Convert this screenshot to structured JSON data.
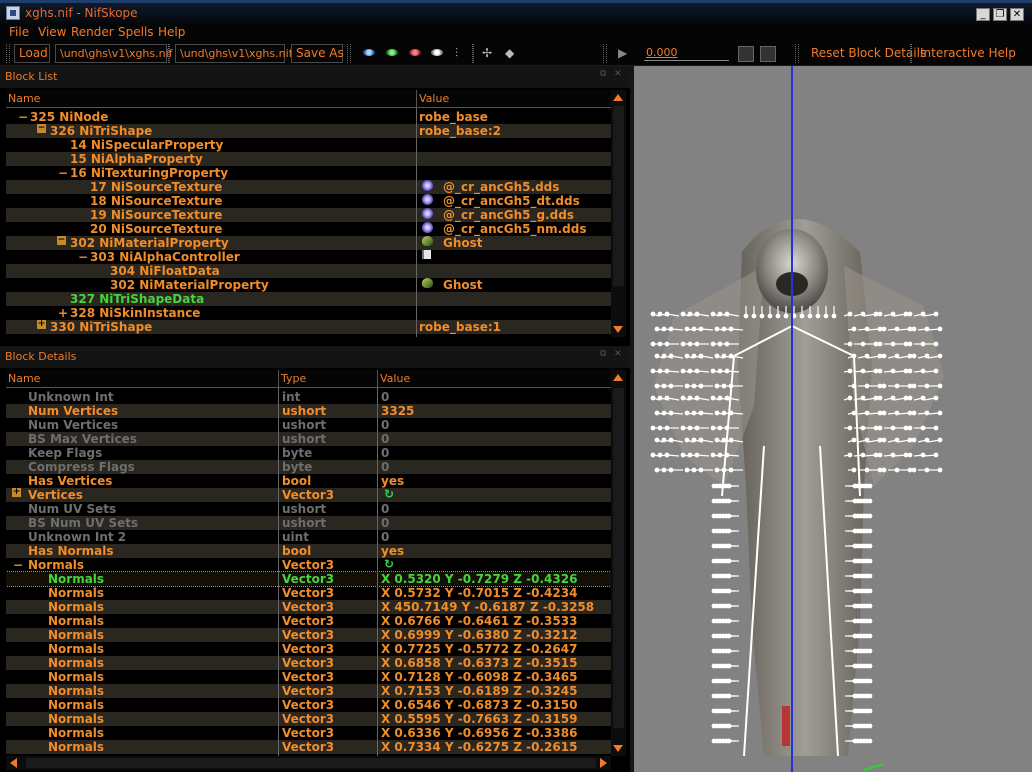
{
  "window": {
    "title": "xghs.nif - NifSkope"
  },
  "menu": [
    "File",
    "View",
    "Render",
    "Spells",
    "Help"
  ],
  "toolbar": {
    "load_label": "Load",
    "path1": "\\und\\ghs\\v1\\xghs.nif",
    "path2": "\\und\\ghs\\v1\\xghs.nif",
    "save_label": "Save As",
    "time_value": "0.000",
    "reset_label": "Reset Block Details",
    "help_label": "Interactive Help"
  },
  "block_list": {
    "title": "Block List",
    "columns": [
      "Name",
      "Value"
    ],
    "rows": [
      {
        "exp": "-",
        "name": "325 NiNode",
        "value": "robe_base",
        "depth": 0,
        "color": "o",
        "icon": ""
      },
      {
        "exp": "box-",
        "name": "326 NiTriShape",
        "value": "robe_base:2",
        "depth": 1,
        "color": "o",
        "icon": ""
      },
      {
        "exp": "",
        "name": "14 NiSpecularProperty",
        "value": "",
        "depth": 2,
        "color": "o",
        "icon": ""
      },
      {
        "exp": "",
        "name": "15 NiAlphaProperty",
        "value": "",
        "depth": 2,
        "color": "o",
        "icon": ""
      },
      {
        "exp": "-",
        "name": "16 NiTexturingProperty",
        "value": "",
        "depth": 2,
        "color": "o",
        "icon": ""
      },
      {
        "exp": "",
        "name": "17 NiSourceTexture",
        "value": "@_cr_ancGh5.dds",
        "depth": 3,
        "color": "o",
        "icon": "tex"
      },
      {
        "exp": "",
        "name": "18 NiSourceTexture",
        "value": "@_cr_ancGh5_dt.dds",
        "depth": 3,
        "color": "o",
        "icon": "tex"
      },
      {
        "exp": "",
        "name": "19 NiSourceTexture",
        "value": "@_cr_ancGh5_g.dds",
        "depth": 3,
        "color": "o",
        "icon": "tex"
      },
      {
        "exp": "",
        "name": "20 NiSourceTexture",
        "value": "@_cr_ancGh5_nm.dds",
        "depth": 3,
        "color": "o",
        "icon": "tex"
      },
      {
        "exp": "box-",
        "name": "302 NiMaterialProperty",
        "value": "Ghost",
        "depth": 2,
        "color": "o",
        "icon": "mat"
      },
      {
        "exp": "-",
        "name": "303 NiAlphaController",
        "value": "",
        "depth": 3,
        "color": "o",
        "icon": "flag"
      },
      {
        "exp": "",
        "name": "304 NiFloatData",
        "value": "",
        "depth": 4,
        "color": "o",
        "icon": ""
      },
      {
        "exp": "",
        "name": "302 NiMaterialProperty",
        "value": "Ghost",
        "depth": 4,
        "color": "o",
        "icon": "mat"
      },
      {
        "exp": "",
        "name": "327 NiTriShapeData",
        "value": "",
        "depth": 2,
        "color": "g",
        "icon": ""
      },
      {
        "exp": "+",
        "name": "328 NiSkinInstance",
        "value": "",
        "depth": 2,
        "color": "o",
        "icon": ""
      },
      {
        "exp": "box+",
        "name": "330 NiTriShape",
        "value": "robe_base:1",
        "depth": 1,
        "color": "o",
        "icon": ""
      }
    ]
  },
  "block_details": {
    "title": "Block Details",
    "columns": [
      "Name",
      "Type",
      "Value"
    ],
    "rows": [
      {
        "exp": "",
        "name": "Unknown Int",
        "type": "int",
        "value": "0",
        "color": "d",
        "icon": ""
      },
      {
        "exp": "",
        "name": "Num Vertices",
        "type": "ushort",
        "value": "3325",
        "color": "o",
        "icon": ""
      },
      {
        "exp": "",
        "name": "Num Vertices",
        "type": "ushort",
        "value": "0",
        "color": "d",
        "icon": ""
      },
      {
        "exp": "",
        "name": "BS Max Vertices",
        "type": "ushort",
        "value": "0",
        "color": "d",
        "icon": ""
      },
      {
        "exp": "",
        "name": "Keep Flags",
        "type": "byte",
        "value": "0",
        "color": "d",
        "icon": ""
      },
      {
        "exp": "",
        "name": "Compress Flags",
        "type": "byte",
        "value": "0",
        "color": "d",
        "icon": ""
      },
      {
        "exp": "",
        "name": "Has Vertices",
        "type": "bool",
        "value": "yes",
        "color": "o",
        "icon": ""
      },
      {
        "exp": "box+",
        "name": "Vertices",
        "type": "Vector3",
        "value": "",
        "color": "o",
        "icon": "refresh"
      },
      {
        "exp": "",
        "name": "Num UV Sets",
        "type": "ushort",
        "value": "0",
        "color": "d",
        "icon": ""
      },
      {
        "exp": "",
        "name": "BS Num UV Sets",
        "type": "ushort",
        "value": "0",
        "color": "d",
        "icon": ""
      },
      {
        "exp": "",
        "name": "Unknown Int 2",
        "type": "uint",
        "value": "0",
        "color": "d",
        "icon": ""
      },
      {
        "exp": "",
        "name": "Has Normals",
        "type": "bool",
        "value": "yes",
        "color": "o",
        "icon": ""
      },
      {
        "exp": "-",
        "name": "Normals",
        "type": "Vector3",
        "value": "",
        "color": "o",
        "icon": "refresh"
      },
      {
        "exp": "",
        "name": "Normals",
        "type": "Vector3",
        "value": "X 0.5320 Y -0.7279 Z -0.4326",
        "color": "g",
        "icon": "",
        "selected": true
      },
      {
        "exp": "",
        "name": "Normals",
        "type": "Vector3",
        "value": "X 0.5732 Y -0.7015 Z -0.4234",
        "color": "o",
        "icon": ""
      },
      {
        "exp": "",
        "name": "Normals",
        "type": "Vector3",
        "value": "X 450.7149 Y -0.6187 Z -0.3258",
        "color": "o",
        "icon": ""
      },
      {
        "exp": "",
        "name": "Normals",
        "type": "Vector3",
        "value": "X 0.6766 Y -0.6461 Z -0.3533",
        "color": "o",
        "icon": ""
      },
      {
        "exp": "",
        "name": "Normals",
        "type": "Vector3",
        "value": "X 0.6999 Y -0.6380 Z -0.3212",
        "color": "o",
        "icon": ""
      },
      {
        "exp": "",
        "name": "Normals",
        "type": "Vector3",
        "value": "X 0.7725 Y -0.5772 Z -0.2647",
        "color": "o",
        "icon": ""
      },
      {
        "exp": "",
        "name": "Normals",
        "type": "Vector3",
        "value": "X 0.6858 Y -0.6373 Z -0.3515",
        "color": "o",
        "icon": ""
      },
      {
        "exp": "",
        "name": "Normals",
        "type": "Vector3",
        "value": "X 0.7128 Y -0.6098 Z -0.3465",
        "color": "o",
        "icon": ""
      },
      {
        "exp": "",
        "name": "Normals",
        "type": "Vector3",
        "value": "X 0.7153 Y -0.6189 Z -0.3245",
        "color": "o",
        "icon": ""
      },
      {
        "exp": "",
        "name": "Normals",
        "type": "Vector3",
        "value": "X 0.6546 Y -0.6873 Z -0.3150",
        "color": "o",
        "icon": ""
      },
      {
        "exp": "",
        "name": "Normals",
        "type": "Vector3",
        "value": "X 0.5595 Y -0.7663 Z -0.3159",
        "color": "o",
        "icon": ""
      },
      {
        "exp": "",
        "name": "Normals",
        "type": "Vector3",
        "value": "X 0.6336 Y -0.6956 Z -0.3386",
        "color": "o",
        "icon": ""
      },
      {
        "exp": "",
        "name": "Normals",
        "type": "Vector3",
        "value": "X 0.7334 Y -0.6275 Z -0.2615",
        "color": "o",
        "icon": ""
      }
    ]
  },
  "colors": {
    "accent": "#f07c2a",
    "highlight": "#45d63a",
    "disabled": "#6e6e6e",
    "viewport_bg": "#828282",
    "axis": "#2233dd"
  },
  "icons": [
    "load-icon",
    "eye-icons",
    "play-icon",
    "camera-icon",
    "texture-icon",
    "material-icon",
    "refresh-icon"
  ]
}
